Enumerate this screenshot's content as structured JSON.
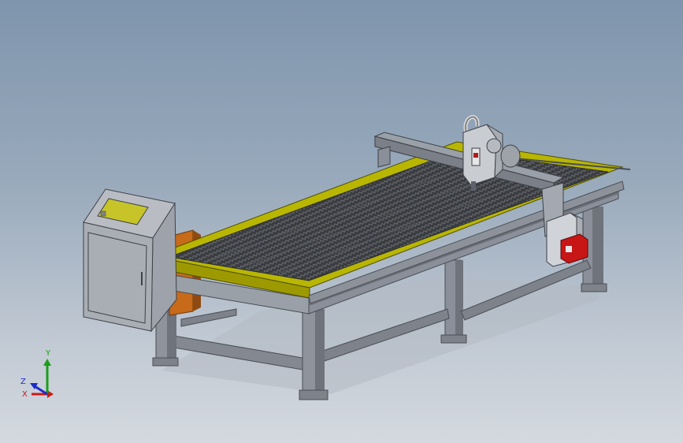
{
  "viewport": {
    "background_top": "#7f95ad",
    "background_bottom": "#d4d9df"
  },
  "model": {
    "components": [
      "control-cabinet",
      "cutting-table",
      "slat-bed",
      "gantry",
      "torch-head",
      "table-legs",
      "electrical-box",
      "motor"
    ],
    "colors": {
      "frame": "#8a8f99",
      "frame_dark": "#5d626b",
      "table_rim": "#b8b600",
      "slat_bed": "#3a3c40",
      "cabinet": "#9ea3ab",
      "cabinet_screen": "#c7c42a",
      "motor": "#c81616",
      "orange_part": "#c76a1a"
    }
  },
  "triad": {
    "x_label": "X",
    "y_label": "Y",
    "z_label": "Z",
    "x_color": "#cc1a1a",
    "y_color": "#1a9e1a",
    "z_color": "#1a2ec8"
  }
}
